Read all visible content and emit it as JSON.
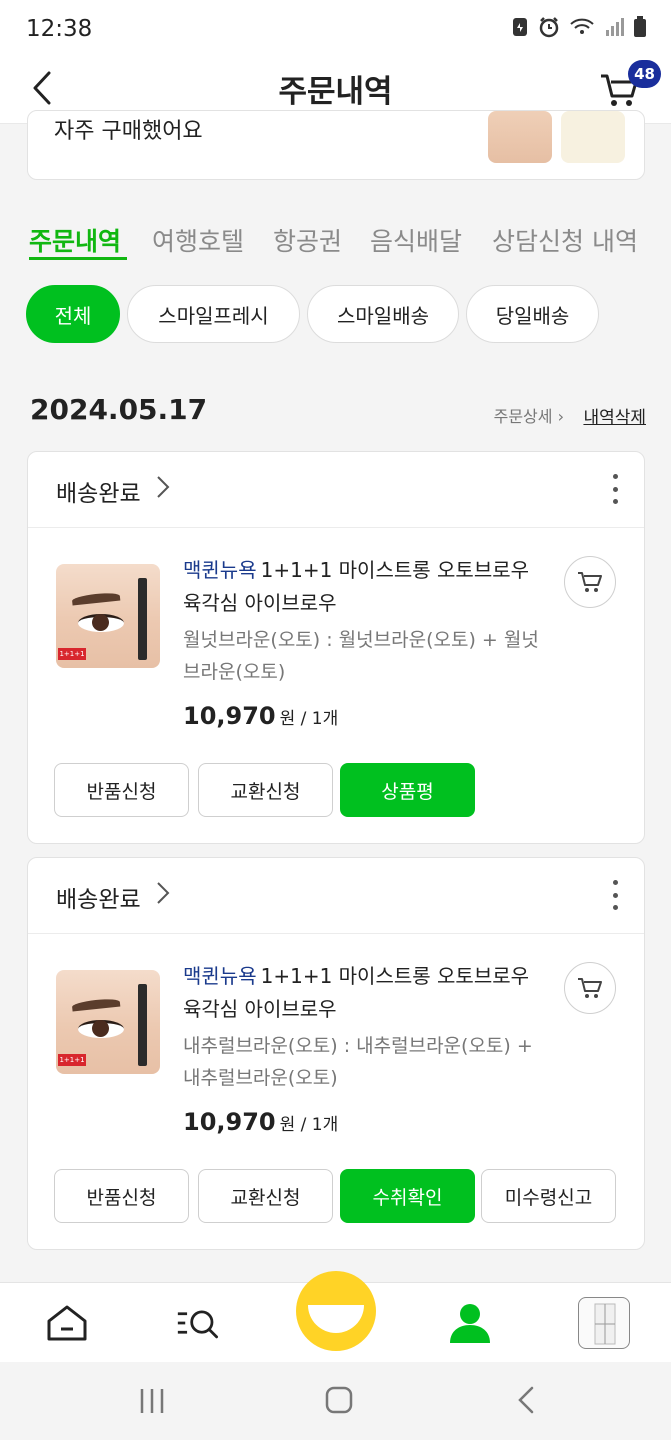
{
  "status_bar": {
    "time": "12:38"
  },
  "header": {
    "title": "주문내역",
    "cart_count": "48"
  },
  "partial_card": {
    "text": "자주 구매했어요"
  },
  "tabs": [
    {
      "label": "주문내역",
      "active": true
    },
    {
      "label": "여행호텔"
    },
    {
      "label": "항공권"
    },
    {
      "label": "음식배달"
    },
    {
      "label": "상담신청 내역"
    }
  ],
  "filters": [
    {
      "label": "전체",
      "active": true
    },
    {
      "label": "스마일프레시"
    },
    {
      "label": "스마일배송"
    },
    {
      "label": "당일배송"
    }
  ],
  "order_group": {
    "date": "2024.05.17",
    "detail_link": "주문상세",
    "delete_link": "내역삭제"
  },
  "orders": [
    {
      "status": "배송완료",
      "brand": "맥퀸뉴욕",
      "name": "1+1+1 마이스트롱 오토브로우 육각심 아이브로우",
      "option": "월넛브라운(오토) : 월넛브라운(오토) + 월넛브라운(오토)",
      "price": "10,970",
      "price_unit": "원 / 1개",
      "thumb_tag": "1+1+1",
      "buttons": [
        "반품신청",
        "교환신청",
        "상품평"
      ]
    },
    {
      "status": "배송완료",
      "brand": "맥퀸뉴욕",
      "name": "1+1+1 마이스트롱 오토브로우 육각심 아이브로우",
      "option": "내추럴브라운(오토) : 내추럴브라운(오토) + 내추럴브라운(오토)",
      "price": "10,970",
      "price_unit": "원 / 1개",
      "thumb_tag": "1+1+1",
      "buttons": [
        "반품신청",
        "교환신청",
        "수취확인",
        "미수령신고"
      ]
    }
  ],
  "bottom_nav": {
    "items": [
      "home-icon",
      "search-menu-icon",
      "smile-logo-icon",
      "profile-icon",
      "recent-view-icon"
    ],
    "active": "profile-icon"
  },
  "colors": {
    "brand_green": "#00c01f",
    "badge_navy": "#1a2e9c",
    "brand_link": "#1a3a8c"
  }
}
